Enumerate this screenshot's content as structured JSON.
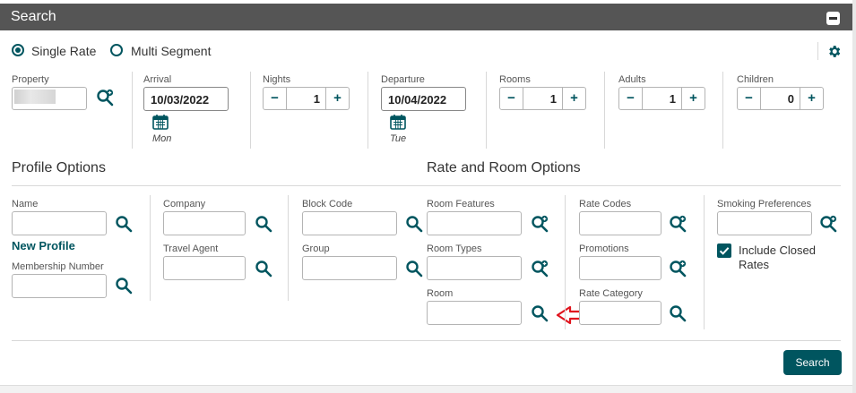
{
  "panel": {
    "title": "Search"
  },
  "rate_mode": {
    "single_label": "Single Rate",
    "multi_label": "Multi Segment",
    "selected": "Single Rate"
  },
  "stay": {
    "property_label": "Property",
    "arrival_label": "Arrival",
    "arrival_value": "10/03/2022",
    "arrival_day": "Mon",
    "nights_label": "Nights",
    "nights_value": "1",
    "departure_label": "Departure",
    "departure_value": "10/04/2022",
    "departure_day": "Tue",
    "rooms_label": "Rooms",
    "rooms_value": "1",
    "adults_label": "Adults",
    "adults_value": "1",
    "children_label": "Children",
    "children_value": "0",
    "minus_glyph": "−",
    "plus_glyph": "+"
  },
  "sections": {
    "profile_options": "Profile Options",
    "rate_room_options": "Rate and Room Options"
  },
  "profile": {
    "name_label": "Name",
    "new_profile": "New Profile",
    "membership_label": "Membership Number",
    "company_label": "Company",
    "travel_agent_label": "Travel Agent",
    "block_code_label": "Block Code",
    "group_label": "Group"
  },
  "room_options": {
    "room_features_label": "Room Features",
    "room_types_label": "Room Types",
    "room_label": "Room",
    "rate_codes_label": "Rate Codes",
    "promotions_label": "Promotions",
    "rate_category_label": "Rate Category",
    "smoking_label": "Smoking Preferences",
    "include_closed_label": "Include Closed",
    "include_closed_label2": "Rates",
    "include_closed_checked": true
  },
  "actions": {
    "search_label": "Search"
  },
  "colors": {
    "accent": "#00555f",
    "header": "#555555",
    "annotation_arrow": "#e0141e"
  }
}
